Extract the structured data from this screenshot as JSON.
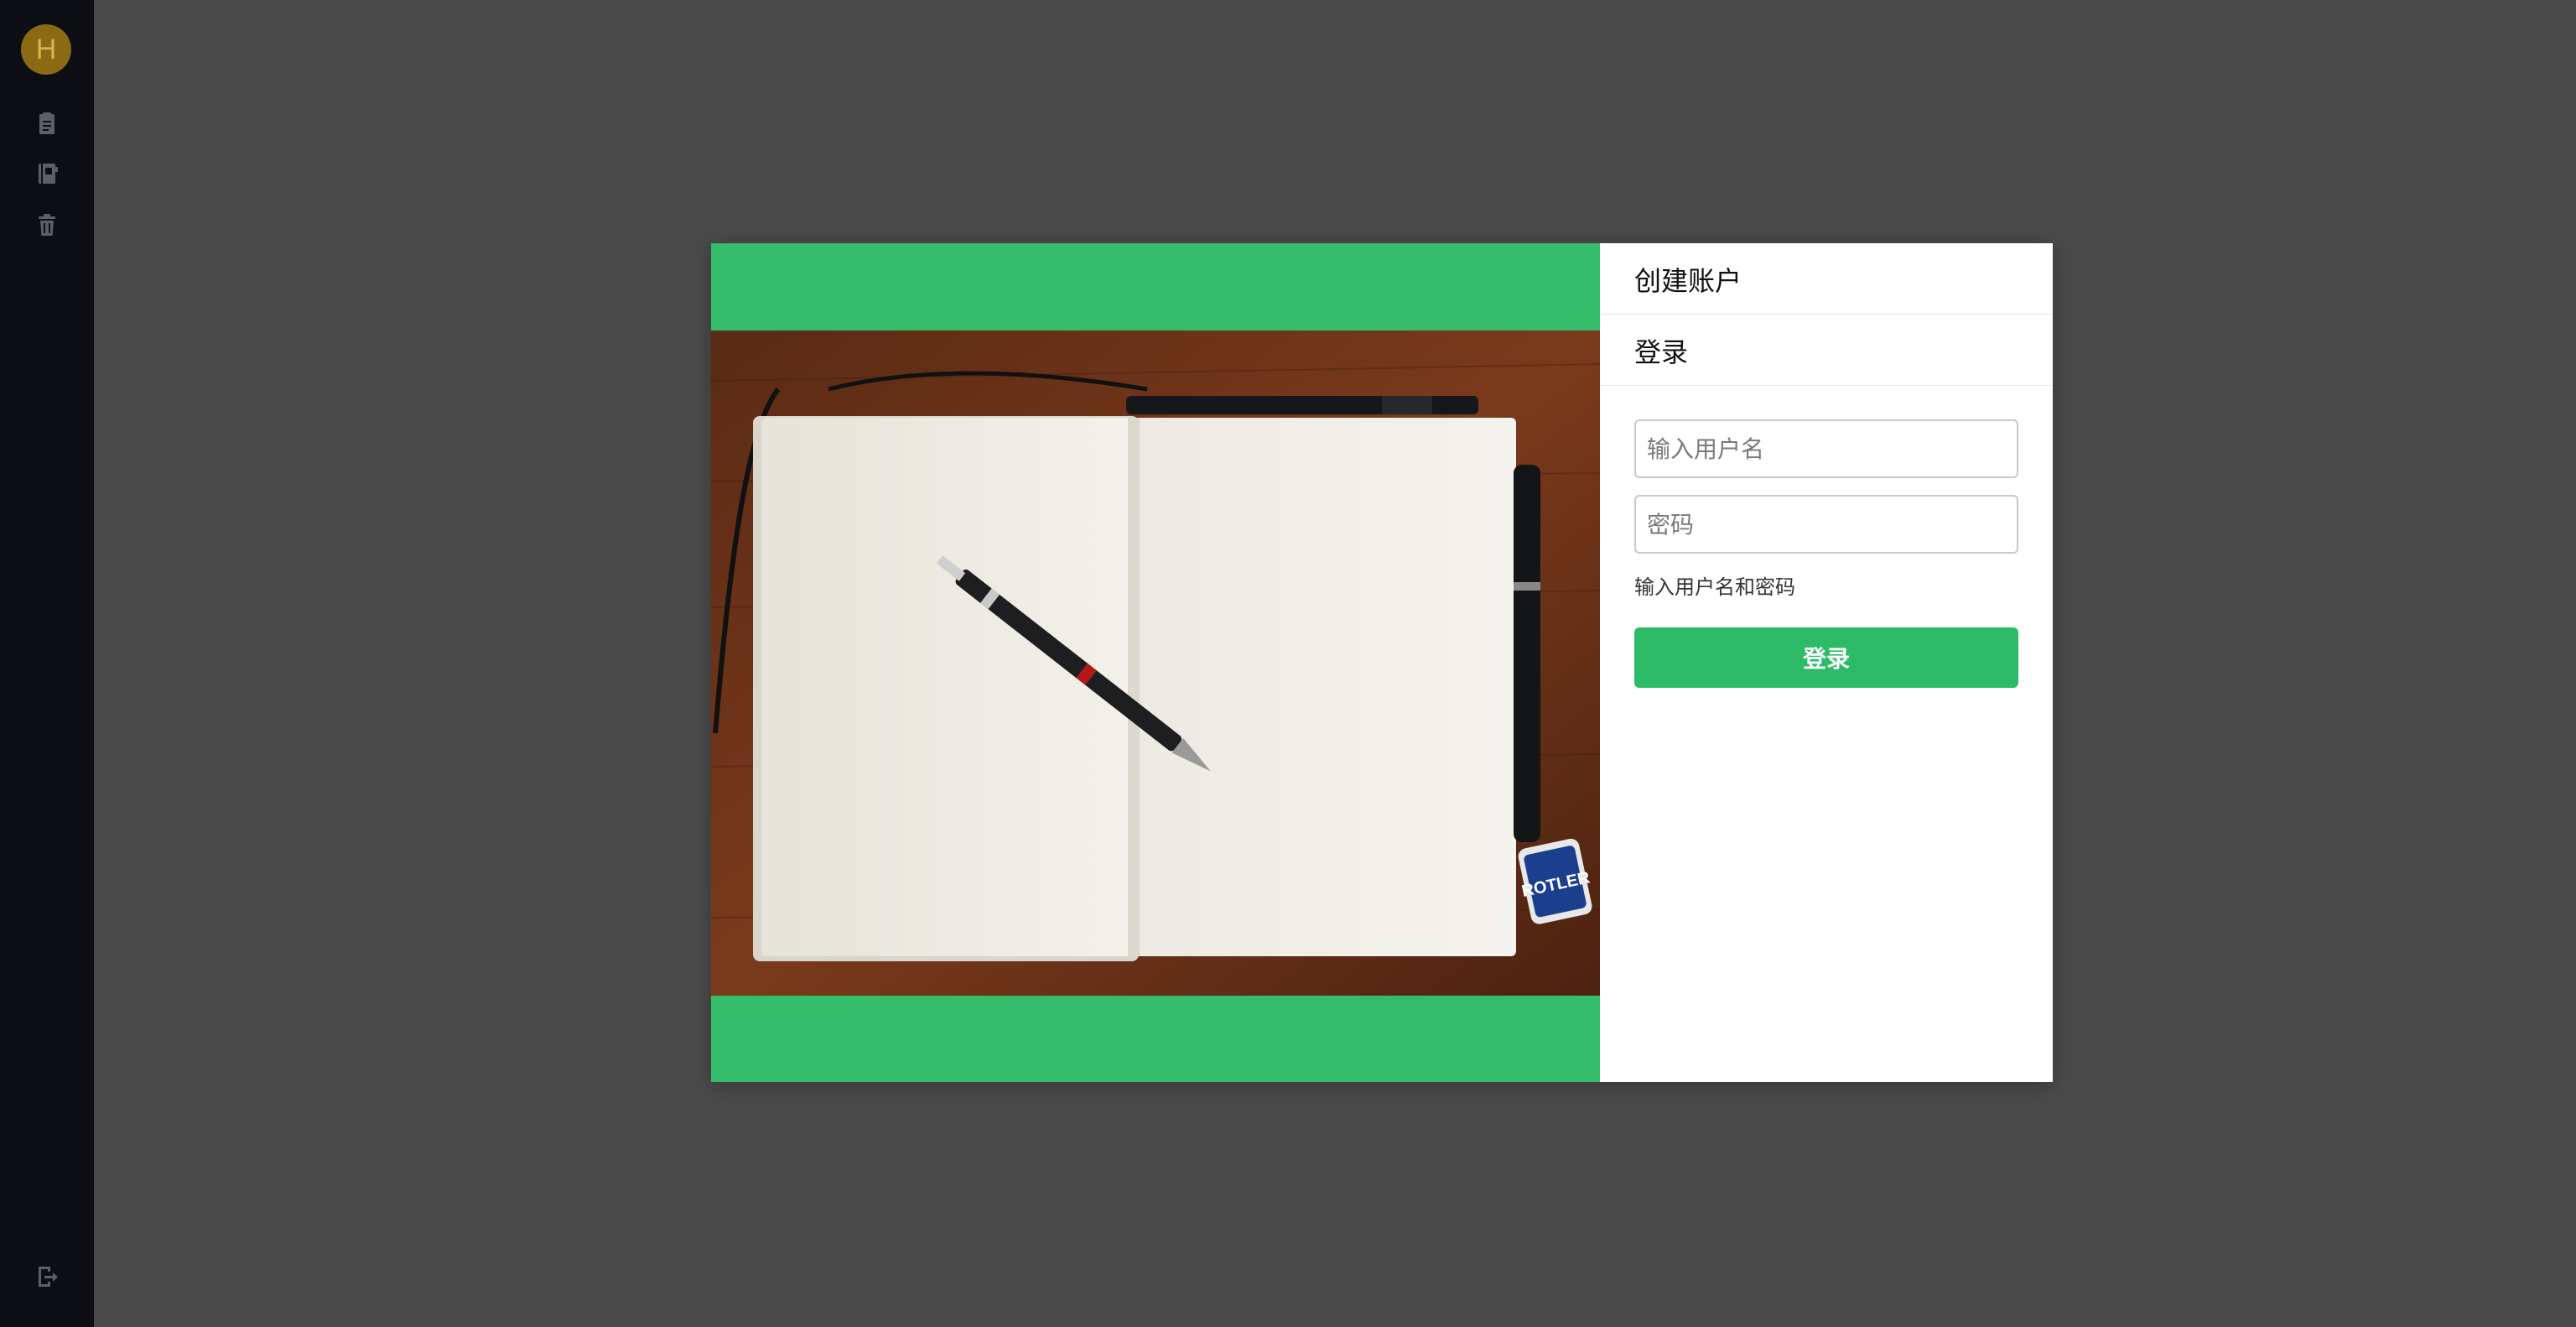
{
  "sidebar": {
    "avatar_letter": "H",
    "icons": [
      "note-icon",
      "notebook-icon",
      "trash-icon"
    ],
    "footer_icon": "logout-icon"
  },
  "modal": {
    "tabs": {
      "create_account": "创建账户",
      "login": "登录"
    },
    "form": {
      "username_placeholder": "输入用户名",
      "password_placeholder": "密码",
      "hint": "输入用户名和密码",
      "submit_label": "登录"
    },
    "image_alt": "open-notebook-with-pencil-photo"
  },
  "colors": {
    "overlay": "#4a4a4b",
    "sidebar": "#0c0e13",
    "avatar": "#8a6a12",
    "hero_green": "#35bd6b",
    "button_green": "#2dbb68"
  }
}
